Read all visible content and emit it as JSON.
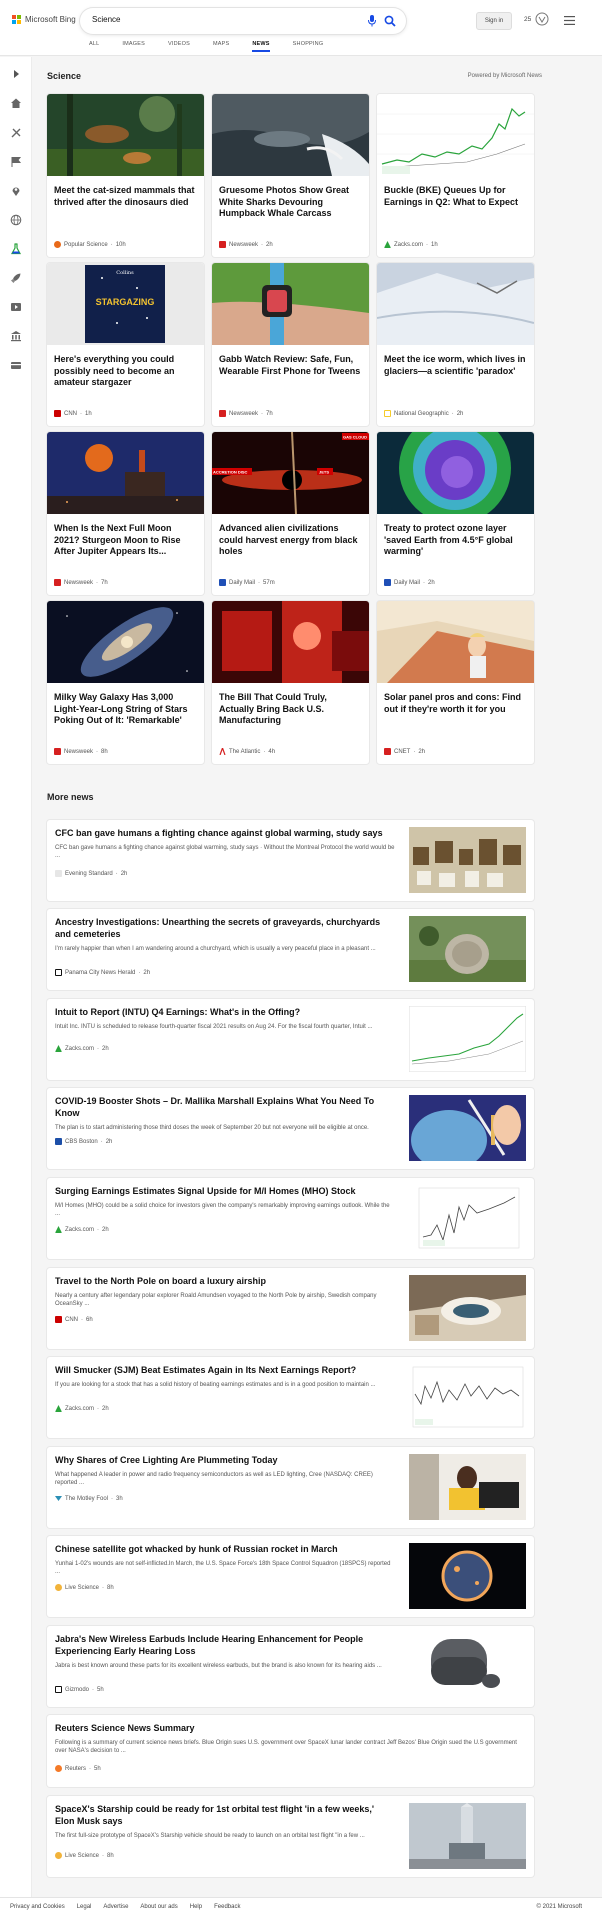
{
  "header": {
    "brand": "Microsoft Bing",
    "search_value": "Science",
    "signin": "Sign in",
    "rewards_points": "25"
  },
  "tabs": [
    "ALL",
    "IMAGES",
    "VIDEOS",
    "MAPS",
    "NEWS",
    "SHOPPING"
  ],
  "active_tab": "NEWS",
  "section": {
    "title": "Science",
    "powered_by": "Powered by Microsoft News"
  },
  "cards": [
    {
      "title": "Meet the cat-sized mammals that thrived after the dinosaurs died",
      "source": "Popular Science",
      "age": "10h"
    },
    {
      "title": "Gruesome Photos Show Great White Sharks Devouring Humpback Whale Carcass",
      "source": "Newsweek",
      "age": "2h"
    },
    {
      "title": "Buckle (BKE) Queues Up for Earnings in Q2: What to Expect",
      "source": "Zacks.com",
      "age": "1h"
    },
    {
      "title": "Here's everything you could possibly need to become an amateur stargazer",
      "source": "CNN",
      "age": "1h"
    },
    {
      "title": "Gabb Watch Review: Safe, Fun, Wearable First Phone for Tweens",
      "source": "Newsweek",
      "age": "7h"
    },
    {
      "title": "Meet the ice worm, which lives in glaciers—a scientific 'paradox'",
      "source": "National Geographic",
      "age": "2h"
    },
    {
      "title": "When Is the Next Full Moon 2021? Sturgeon Moon to Rise After Jupiter Appears Its...",
      "source": "Newsweek",
      "age": "7h"
    },
    {
      "title": "Advanced alien civilizations could harvest energy from black holes",
      "source": "Daily Mail",
      "age": "57m"
    },
    {
      "title": "Treaty to protect ozone layer 'saved Earth from 4.5°F global warming'",
      "source": "Daily Mail",
      "age": "2h"
    },
    {
      "title": "Milky Way Galaxy Has 3,000 Light-Year-Long String of Stars Poking Out of It: 'Remarkable'",
      "source": "Newsweek",
      "age": "8h"
    },
    {
      "title": "The Bill That Could Truly, Actually Bring Back U.S. Manufacturing",
      "source": "The Atlantic",
      "age": "4h"
    },
    {
      "title": "Solar panel pros and cons: Find out if they're worth it for you",
      "source": "CNET",
      "age": "2h"
    }
  ],
  "card_images": {
    "stargazing_book_title": "STARGAZING",
    "stargazing_book_publisher": "Collins",
    "blackhole_label_1": "ACCRETION DISC",
    "blackhole_label_2": "JETS",
    "blackhole_label_3": "GAS CLOUD"
  },
  "more_news_title": "More news",
  "news": [
    {
      "title": "CFC ban gave humans a fighting chance against global warming, study says",
      "snippet": "CFC ban gave humans a fighting chance against global warming, study says · Without the Montreal Protocol the world would be ...",
      "source": "Evening Standard",
      "age": "2h"
    },
    {
      "title": "Ancestry Investigations: Unearthing the secrets of graveyards, churchyards and cemeteries",
      "snippet": "I'm rarely happier than when I am wandering around a churchyard, which is usually a very peaceful place in a pleasant ...",
      "source": "Panama City News Herald",
      "age": "2h"
    },
    {
      "title": "Intuit to Report (INTU) Q4 Earnings: What's in the Offing?",
      "snippet": "Intuit Inc. INTU is scheduled to release fourth-quarter fiscal 2021 results on Aug 24. For the fiscal fourth quarter, Intuit ...",
      "source": "Zacks.com",
      "age": "2h"
    },
    {
      "title": "COVID-19 Booster Shots – Dr. Mallika Marshall Explains What You Need To Know",
      "snippet": "The plan is to start administering those third doses the week of September 20 but not everyone will be eligible at once.",
      "source": "CBS Boston",
      "age": "2h"
    },
    {
      "title": "Surging Earnings Estimates Signal Upside for M/I Homes (MHO) Stock",
      "snippet": "M/I Homes (MHO) could be a solid choice for investors given the company's remarkably improving earnings outlook. While the ...",
      "source": "Zacks.com",
      "age": "2h"
    },
    {
      "title": "Travel to the North Pole on board a luxury airship",
      "snippet": "Nearly a century after legendary polar explorer Roald Amundsen voyaged to the North Pole by airship, Swedish company OceanSky ...",
      "source": "CNN",
      "age": "6h"
    },
    {
      "title": "Will Smucker (SJM) Beat Estimates Again in Its Next Earnings Report?",
      "snippet": "If you are looking for a stock that has a solid history of beating earnings estimates and is in a good position to maintain ...",
      "source": "Zacks.com",
      "age": "2h"
    },
    {
      "title": "Why Shares of Cree Lighting Are Plummeting Today",
      "snippet": "What happened A leader in power and radio frequency semiconductors as well as LED lighting, Cree (NASDAQ: CREE) reported ...",
      "source": "The Motley Fool",
      "age": "3h"
    },
    {
      "title": "Chinese satellite got whacked by hunk of Russian rocket in March",
      "snippet": "Yunhai 1-02's wounds are not self-inflicted.In March, the U.S. Space Force's 18th Space Control Squadron (18SPCS) reported ...",
      "source": "Live Science",
      "age": "8h"
    },
    {
      "title": "Jabra's New Wireless Earbuds Include Hearing Enhancement for People Experiencing Early Hearing Loss",
      "snippet": "Jabra is best known around these parts for its excellent wireless earbuds, but the brand is also known for its hearing aids ...",
      "source": "Gizmodo",
      "age": "5h"
    },
    {
      "title": "Reuters Science News Summary",
      "snippet": "Following is a summary of current science news briefs. Blue Origin sues U.S. government over SpaceX lunar lander contract Jeff Bezos' Blue Origin sued the U.S government over NASA's decision to ...",
      "source": "Reuters",
      "age": "5h"
    },
    {
      "title": "SpaceX's Starship could be ready for 1st orbital test flight 'in a few weeks,' Elon Musk says",
      "snippet": "The first full-size prototype of SpaceX's Starship vehicle should be ready to launch on an orbital test flight \"in a few ...",
      "source": "Live Science",
      "age": "8h"
    }
  ],
  "footer": {
    "links": [
      "Privacy and Cookies",
      "Legal",
      "Advertise",
      "About our ads",
      "Help",
      "Feedback"
    ],
    "copyright": "© 2021 Microsoft"
  },
  "colors": {
    "accent": "#174ae4",
    "zacks_green": "#2aa43c",
    "newsweek_red": "#d62020",
    "cnn_red": "#cc0000"
  }
}
